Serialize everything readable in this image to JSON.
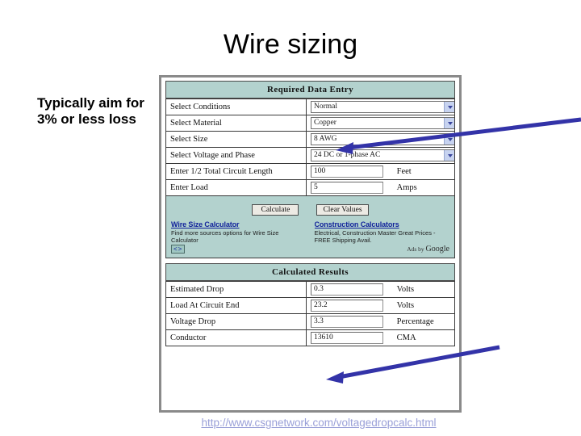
{
  "slide": {
    "title": "Wire sizing",
    "note": "Typically aim for 3% or less loss",
    "source_url": "http://www.csgnetwork.com/voltagedropcalc.html"
  },
  "calculator": {
    "entry_section_title": "Required Data Entry",
    "results_section_title": "Calculated Results",
    "entry_rows": [
      {
        "label": "Select Conditions",
        "control": "select",
        "value": "Normal",
        "unit": ""
      },
      {
        "label": "Select Material",
        "control": "select",
        "value": "Copper",
        "unit": ""
      },
      {
        "label": "Select Size",
        "control": "select",
        "value": "8 AWG",
        "unit": ""
      },
      {
        "label": "Select Voltage and Phase",
        "control": "select",
        "value": "24 DC or 1-phase AC",
        "unit": ""
      },
      {
        "label": "Enter 1/2 Total Circuit Length",
        "control": "text",
        "value": "100",
        "unit": "Feet"
      },
      {
        "label": "Enter Load",
        "control": "text",
        "value": "5",
        "unit": "Amps"
      }
    ],
    "buttons": {
      "calculate": "Calculate",
      "clear": "Clear Values"
    },
    "ads": {
      "left": {
        "title": "Wire Size Calculator",
        "body": "Find more sources options for Wire Size Calculator"
      },
      "right": {
        "title": "Construction Calculators",
        "body": "Electrical, Construction Master Great Prices - FREE Shipping Avail."
      },
      "pager": "<>",
      "attribution": "Ads by",
      "attribution_brand": "Google"
    },
    "result_rows": [
      {
        "label": "Estimated Drop",
        "value": "0.3",
        "unit": "Volts"
      },
      {
        "label": "Load At Circuit End",
        "value": "23.2",
        "unit": "Volts"
      },
      {
        "label": "Voltage Drop",
        "value": "3.3",
        "unit": "Percentage"
      },
      {
        "label": "Conductor",
        "value": "13610",
        "unit": "CMA"
      }
    ]
  },
  "annotations": {
    "arrow_color": "#3333a8",
    "arrow_1": {
      "label": "arrow-pointing-to-select-size"
    },
    "arrow_2": {
      "label": "arrow-pointing-to-voltage-drop"
    }
  },
  "colors": {
    "section_header_bg": "#b3d2ce",
    "link_blue": "#12239b",
    "url_caption": "#9aa0d8"
  }
}
